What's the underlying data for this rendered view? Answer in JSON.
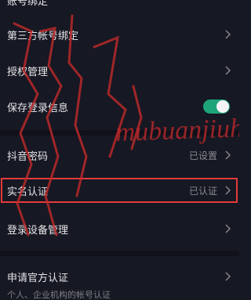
{
  "top_partial_label": "账号绑定",
  "rows": {
    "third_party": {
      "label": "第三方帐号绑定"
    },
    "authorization": {
      "label": "授权管理"
    },
    "save_login": {
      "label": "保存登录信息",
      "toggle_on": true
    },
    "douyin_password": {
      "label": "抖音密码",
      "value": "已设置"
    },
    "real_name": {
      "label": "实名认证",
      "value": "已认证"
    },
    "device_manage": {
      "label": "登录设备管理"
    },
    "official_cert": {
      "label": "申请官方认证",
      "subtext": "个人、企业机构的帐号认证"
    }
  },
  "colors": {
    "background": "#161823",
    "toggle_on": "#1fa47a",
    "highlight_border": "#e53b3b",
    "watermark": "#c62a2a"
  },
  "icons": {
    "chevron": "chevron-right-icon"
  },
  "watermark": {
    "text": "mubuanjiuhe"
  }
}
